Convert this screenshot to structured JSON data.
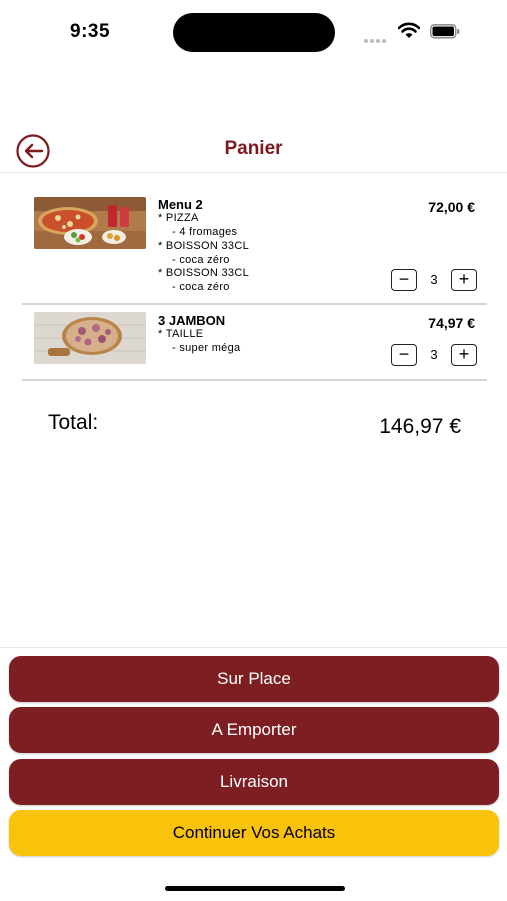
{
  "status": {
    "time": "9:35"
  },
  "nav": {
    "title": "Panier",
    "back_icon": "arrow-left-circle-icon"
  },
  "items": [
    {
      "name": "Menu 2",
      "price": "72,00 €",
      "options": [
        {
          "label": "* PIZZA",
          "value": "- 4 fromages"
        },
        {
          "label": "* BOISSON 33CL",
          "value": "- coca zéro"
        },
        {
          "label": "* BOISSON 33CL",
          "value": "- coca zéro"
        }
      ],
      "quantity": "3"
    },
    {
      "name": "3 JAMBON",
      "price": "74,97 €",
      "options": [
        {
          "label": "* TAILLE",
          "value": "- super méga"
        }
      ],
      "quantity": "3"
    }
  ],
  "total": {
    "label": "Total:",
    "value": "146,97 €"
  },
  "buttons": {
    "sur_place": "Sur Place",
    "a_emporter": "A Emporter",
    "livraison": "Livraison",
    "continuer": "Continuer Vos Achats"
  },
  "colors": {
    "brand": "#7d1f22",
    "accent": "#f9c20b"
  },
  "icons": {
    "minus": "minus-icon",
    "plus": "plus-icon"
  }
}
